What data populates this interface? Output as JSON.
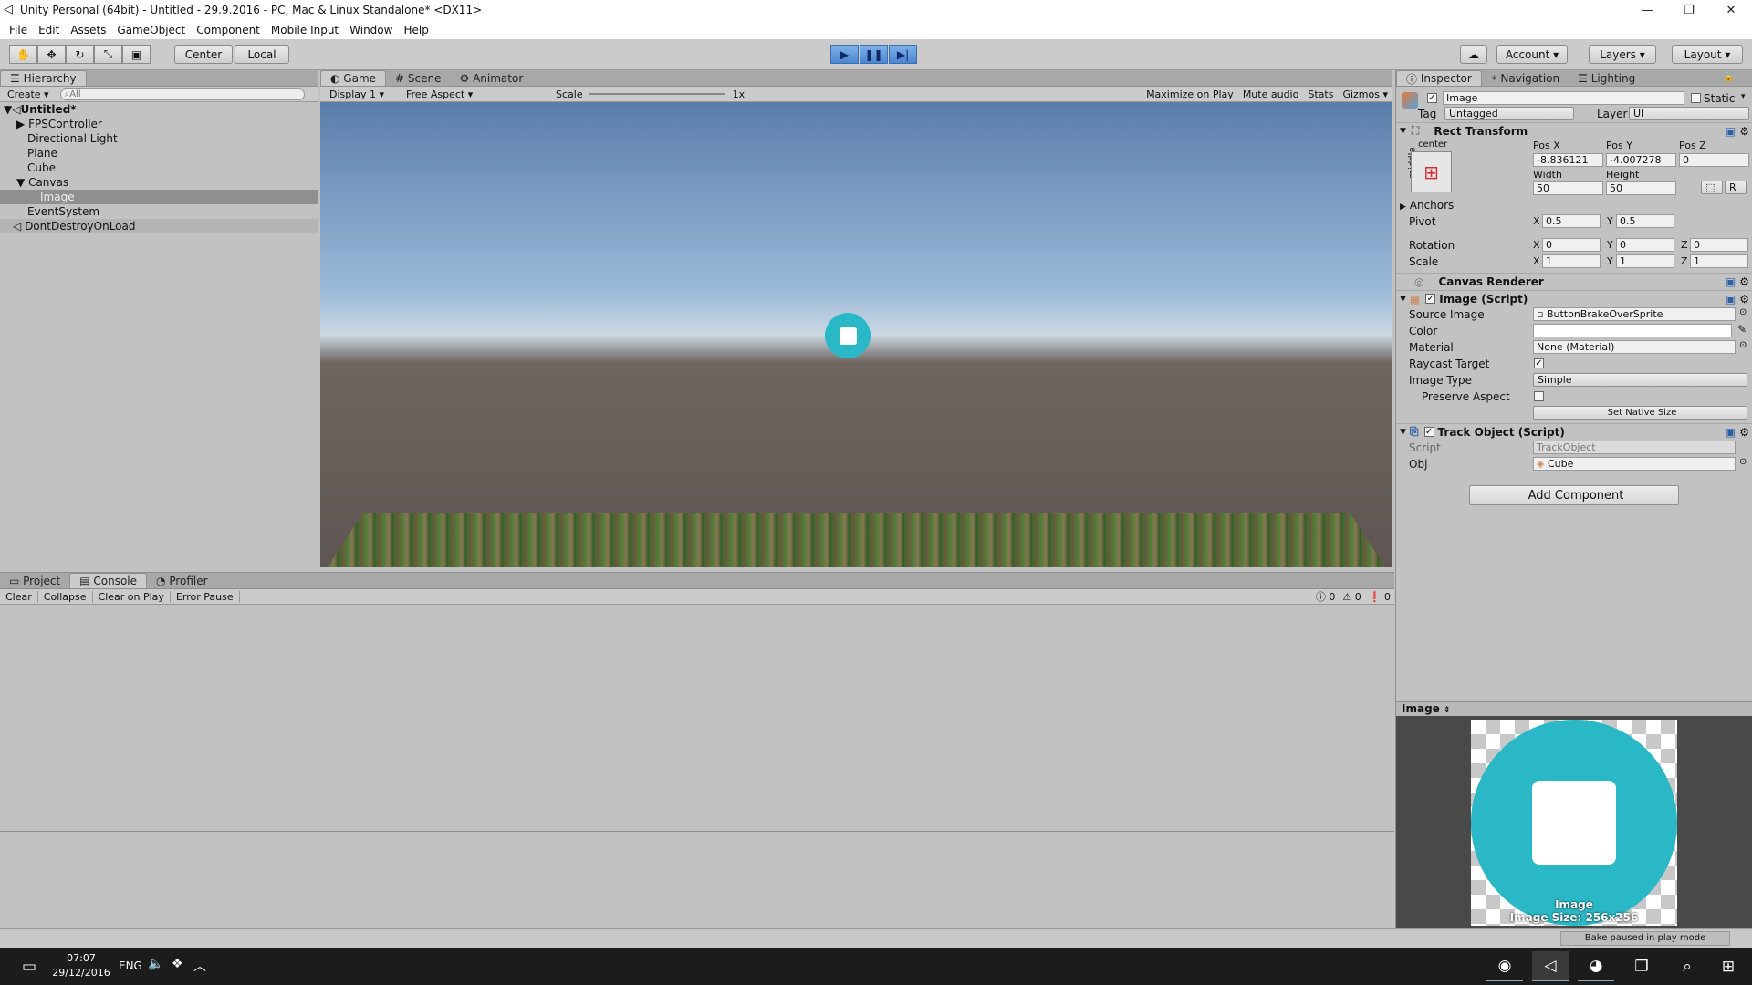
{
  "window": {
    "title": "Unity Personal (64bit) - Untitled - 29.9.2016 - PC, Mac & Linux Standalone* <DX11>",
    "min_icon": "minimize-icon",
    "max_icon": "restore-icon",
    "close_icon": "close-icon"
  },
  "menu": [
    "File",
    "Edit",
    "Assets",
    "GameObject",
    "Component",
    "Mobile Input",
    "Window",
    "Help"
  ],
  "toolbar": {
    "tools": [
      "hand-icon",
      "move-icon",
      "rotate-icon",
      "scale-icon",
      "rect-icon"
    ],
    "center": "Center",
    "local": "Local",
    "account": "Account",
    "layers": "Layers",
    "layout": "Layout"
  },
  "hierarchy": {
    "tab": "Hierarchy",
    "create": "Create",
    "search_placeholder": "All",
    "scene": "Untitled*",
    "items": [
      "FPSController",
      "Directional Light",
      "Plane",
      "Cube",
      "Canvas",
      "Image",
      "EventSystem"
    ],
    "dontdestroy": "DontDestroyOnLoad"
  },
  "game": {
    "tabs": [
      "Game",
      "Scene",
      "Animator"
    ],
    "display": "Display 1",
    "aspect": "Free Aspect",
    "scale_label": "Scale",
    "scale_value": "1x",
    "maximize": "Maximize on Play",
    "mute": "Mute audio",
    "stats": "Stats",
    "gizmos": "Gizmos"
  },
  "console": {
    "tabs": [
      "Project",
      "Console",
      "Profiler"
    ],
    "clear": "Clear",
    "collapse": "Collapse",
    "clear_on_play": "Clear on Play",
    "error_pause": "Error Pause",
    "count_info": "0",
    "count_warn": "0",
    "count_error": "0"
  },
  "inspector": {
    "tabs": [
      "Inspector",
      "Navigation",
      "Lighting"
    ],
    "name": "Image",
    "static": "Static",
    "tag_label": "Tag",
    "tag": "Untagged",
    "layer_label": "Layer",
    "layer": "UI",
    "rect": {
      "title": "Rect Transform",
      "anchor_h": "center",
      "anchor_v": "middle",
      "posx_label": "Pos X",
      "posy_label": "Pos Y",
      "posz_label": "Pos Z",
      "posx": "-8.836121",
      "posy": "-4.007278",
      "posz": "0",
      "width_label": "Width",
      "height_label": "Height",
      "width": "50",
      "height": "50",
      "r": "R",
      "anchors": "Anchors",
      "pivot": "Pivot",
      "pivot_x": "0.5",
      "pivot_y": "0.5",
      "rotation": "Rotation",
      "rot_x": "0",
      "rot_y": "0",
      "rot_z": "0",
      "scale": "Scale",
      "scale_x": "1",
      "scale_y": "1",
      "scale_z": "1",
      "x": "X",
      "y": "Y",
      "z": "Z"
    },
    "canvas_renderer": "Canvas Renderer",
    "image_script": {
      "title": "Image (Script)",
      "source_label": "Source Image",
      "source": "ButtonBrakeOverSprite",
      "color_label": "Color",
      "material_label": "Material",
      "material": "None (Material)",
      "raycast_label": "Raycast Target",
      "type_label": "Image Type",
      "type": "Simple",
      "preserve_label": "Preserve Aspect",
      "native": "Set Native Size"
    },
    "track": {
      "title": "Track Object (Script)",
      "script_label": "Script",
      "script": "TrackObject",
      "obj_label": "Obj",
      "obj": "Cube"
    },
    "add_component": "Add Component",
    "preview_title": "Image",
    "preview_name": "Image",
    "preview_size": "Image Size: 256x256"
  },
  "status": {
    "bake": "Bake paused in play mode"
  },
  "taskbar": {
    "time": "07:07",
    "date": "29/12/2016",
    "lang": "ENG"
  }
}
